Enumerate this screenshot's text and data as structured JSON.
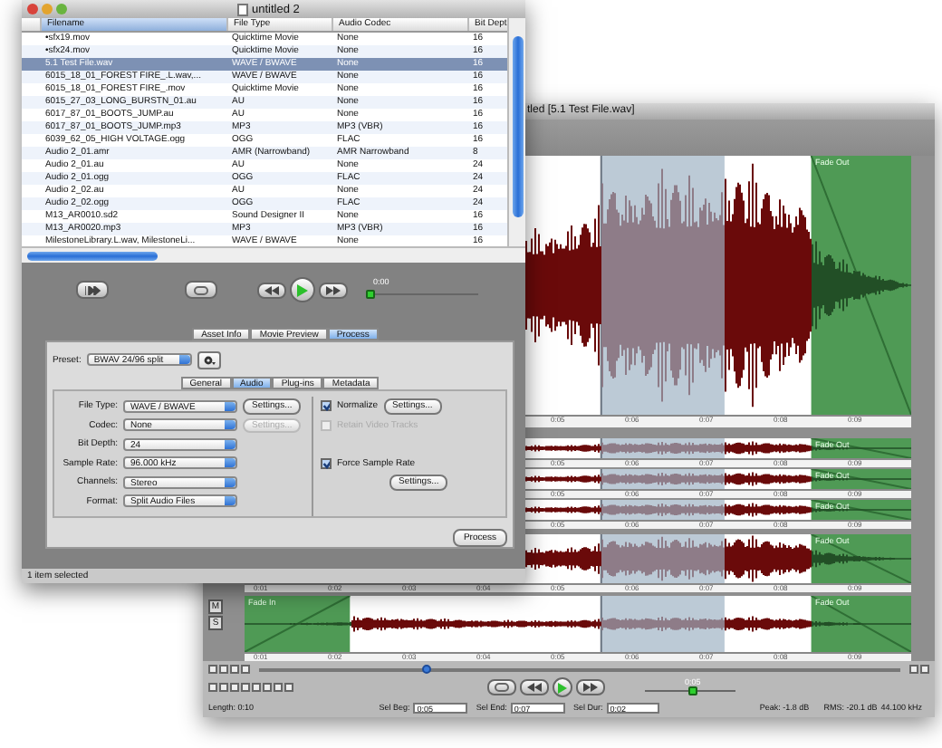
{
  "back_window": {
    "title": "tled [5.1 Test File.wav]",
    "tracks": [
      {
        "kind": "large",
        "fade_out": "Fade Out",
        "ruler": [
          "0:05",
          "0:06",
          "0:07",
          "0:08",
          "0:09"
        ]
      },
      {
        "kind": "small",
        "fade_out": "Fade Out",
        "ruler": [
          "0:05",
          "0:06",
          "0:07",
          "0:08",
          "0:09"
        ]
      },
      {
        "kind": "small",
        "fade_out": "Fade Out",
        "ruler": [
          "0:05",
          "0:06",
          "0:07",
          "0:08",
          "0:09"
        ]
      },
      {
        "kind": "small",
        "fade_out": "Fade Out",
        "ruler": [
          "0:05",
          "0:06",
          "0:07",
          "0:08",
          "0:09"
        ]
      },
      {
        "kind": "medium",
        "fade_out": "Fade Out",
        "ruler": [
          "0:01",
          "0:02",
          "0:03",
          "0:04",
          "0:05",
          "0:06",
          "0:07",
          "0:08",
          "0:09"
        ]
      },
      {
        "kind": "bottom",
        "fade_in": "Fade In",
        "fade_out": "Fade Out",
        "mute": "M",
        "solo": "S",
        "ruler": [
          "0:01",
          "0:02",
          "0:03",
          "0:04",
          "0:05",
          "0:06",
          "0:07",
          "0:08",
          "0:09"
        ]
      }
    ],
    "zoom": {
      "level": 0.26
    },
    "transport": {
      "time": "0:05",
      "level": 0.53
    },
    "status": {
      "length": "Length: 0:10",
      "fields": [
        {
          "label": "Sel Beg:",
          "value": "0:05"
        },
        {
          "label": "Sel End:",
          "value": "0:07"
        },
        {
          "label": "Sel Dur:",
          "value": "0:02"
        }
      ],
      "peak": "Peak: -1.8 dB",
      "rms": "RMS: -20.1 dB",
      "rate": "44.100 kHz"
    }
  },
  "front_window": {
    "title": "untitled 2",
    "table": {
      "columns": [
        {
          "label": "Filename",
          "sorted": true
        },
        {
          "label": "File Type",
          "sorted": false
        },
        {
          "label": "Audio Codec",
          "sorted": false
        },
        {
          "label": "Bit Dept",
          "sorted": false
        }
      ],
      "rows": [
        {
          "cells": [
            "•sfx19.mov",
            "Quicktime Movie",
            "None",
            "16"
          ],
          "selected": false
        },
        {
          "cells": [
            "•sfx24.mov",
            "Quicktime Movie",
            "None",
            "16"
          ],
          "selected": false
        },
        {
          "cells": [
            "5.1 Test File.wav",
            "WAVE / BWAVE",
            "None",
            "16"
          ],
          "selected": true
        },
        {
          "cells": [
            "6015_18_01_FOREST FIRE_.L.wav,...",
            "WAVE / BWAVE",
            "None",
            "16"
          ],
          "selected": false
        },
        {
          "cells": [
            "6015_18_01_FOREST FIRE_.mov",
            "Quicktime Movie",
            "None",
            "16"
          ],
          "selected": false
        },
        {
          "cells": [
            "6015_27_03_LONG_BURSTN_01.au",
            "AU",
            "None",
            "16"
          ],
          "selected": false
        },
        {
          "cells": [
            "6017_87_01_BOOTS_JUMP.au",
            "AU",
            "None",
            "16"
          ],
          "selected": false
        },
        {
          "cells": [
            "6017_87_01_BOOTS_JUMP.mp3",
            "MP3",
            "MP3 (VBR)",
            "16"
          ],
          "selected": false
        },
        {
          "cells": [
            "6039_62_05_HIGH VOLTAGE.ogg",
            "OGG",
            "FLAC",
            "16"
          ],
          "selected": false
        },
        {
          "cells": [
            "Audio 2_01.amr",
            "AMR (Narrowband)",
            "AMR Narrowband",
            "8"
          ],
          "selected": false
        },
        {
          "cells": [
            "Audio 2_01.au",
            "AU",
            "None",
            "24"
          ],
          "selected": false
        },
        {
          "cells": [
            "Audio 2_01.ogg",
            "OGG",
            "FLAC",
            "24"
          ],
          "selected": false
        },
        {
          "cells": [
            "Audio 2_02.au",
            "AU",
            "None",
            "24"
          ],
          "selected": false
        },
        {
          "cells": [
            "Audio 2_02.ogg",
            "OGG",
            "FLAC",
            "24"
          ],
          "selected": false
        },
        {
          "cells": [
            "M13_AR0010.sd2",
            "Sound Designer II",
            "None",
            "16"
          ],
          "selected": false
        },
        {
          "cells": [
            "M13_AR0020.mp3",
            "MP3",
            "MP3 (VBR)",
            "16"
          ],
          "selected": false
        },
        {
          "cells": [
            "MilestoneLibrary.L.wav, MilestoneLi...",
            "WAVE / BWAVE",
            "None",
            "16"
          ],
          "selected": false
        }
      ]
    },
    "transport": {
      "time": "0:00",
      "level": 0.0
    },
    "tabs": [
      {
        "label": "Asset Info",
        "selected": false
      },
      {
        "label": "Movie Preview",
        "selected": false
      },
      {
        "label": "Process",
        "selected": true
      }
    ],
    "preset": {
      "label": "Preset:",
      "value": "BWAV 24/96 split"
    },
    "subtabs": [
      {
        "label": "General",
        "selected": false
      },
      {
        "label": "Audio",
        "selected": true
      },
      {
        "label": "Plug-ins",
        "selected": false
      },
      {
        "label": "Metadata",
        "selected": false
      }
    ],
    "fields": [
      {
        "label": "File Type:",
        "value": "WAVE / BWAVE",
        "settings": {
          "label": "Settings...",
          "disabled": false
        }
      },
      {
        "label": "Codec:",
        "value": "None",
        "settings": {
          "label": "Settings...",
          "disabled": true
        }
      },
      {
        "label": "Bit Depth:",
        "value": "24"
      },
      {
        "label": "Sample Rate:",
        "value": "96.000 kHz"
      },
      {
        "label": "Channels:",
        "value": "Stereo"
      },
      {
        "label": "Format:",
        "value": "Split Audio Files"
      }
    ],
    "options": [
      {
        "label": "Normalize",
        "checked": true,
        "disabled": false,
        "settings": "Settings..."
      },
      {
        "label": "Retain Video Tracks",
        "checked": false,
        "disabled": true
      },
      {
        "label": "Force Sample Rate",
        "checked": true,
        "disabled": false
      }
    ],
    "rate_settings": "Settings...",
    "process_button": "Process",
    "status": "1 item selected"
  }
}
